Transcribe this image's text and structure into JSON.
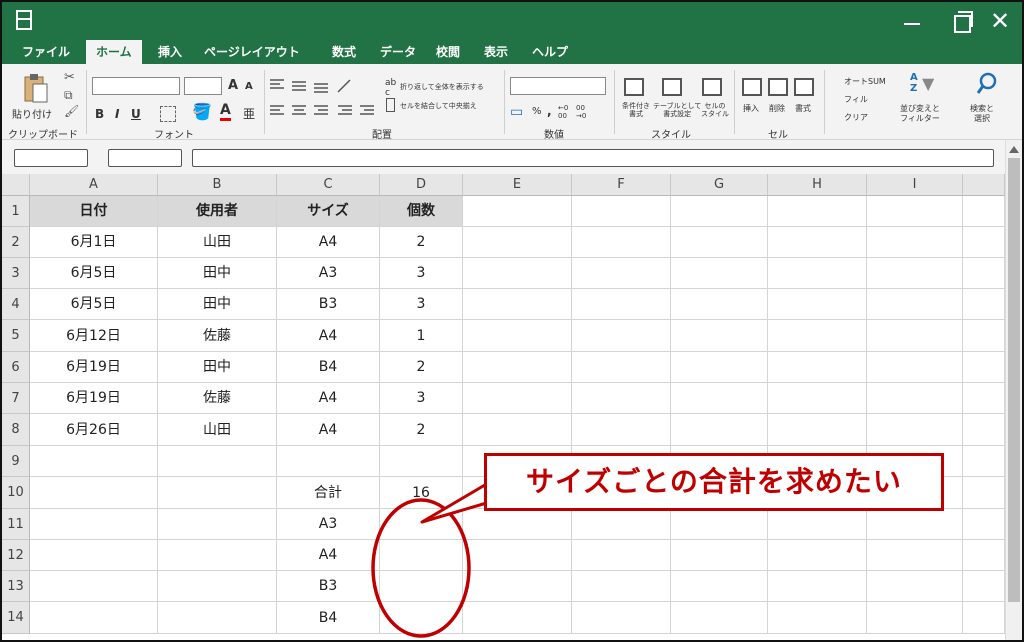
{
  "menu": {
    "tabs": [
      "ファイル",
      "ホーム",
      "挿入",
      "ページレイアウト",
      "数式",
      "データ",
      "校閲",
      "表示",
      "ヘルプ"
    ],
    "active": "ホーム"
  },
  "ribbon": {
    "clipboard": {
      "paste": "貼り付け",
      "group": "クリップボード"
    },
    "font": {
      "group": "フォント",
      "bold": "B",
      "italic": "I",
      "underline": "U",
      "grow": "A",
      "shrink": "A",
      "color": "A",
      "phonetic": "亜"
    },
    "alignment": {
      "wrap": "折り返して全体を表示する",
      "merge": "セルを結合して中央揃え",
      "group": "配置",
      "abc": "ab",
      "c": "c"
    },
    "number": {
      "group": "数値",
      "percent": "%",
      "comma": ",",
      "inc_decimal_a": "←0",
      "inc_decimal_b": "00",
      "dec_decimal_a": "00",
      "dec_decimal_b": "→0"
    },
    "styles": {
      "conditional": "条件付き\n書式",
      "table": "テーブルとして\n書式設定",
      "cell_style": "セルの\nスタイル",
      "group": "スタイル"
    },
    "cells": {
      "insert": "挿入",
      "delete": "削除",
      "format": "書式",
      "group": "セル"
    },
    "editing": {
      "autosum": "オートSUM",
      "fill": "フィル",
      "clear": "クリア",
      "sort": "並び変えと\nフィルター",
      "find": "検索と\n選択",
      "sort_icon_a": "A",
      "sort_icon_z": "Z"
    }
  },
  "columns": [
    "A",
    "B",
    "C",
    "D",
    "E",
    "F",
    "G",
    "H",
    "I"
  ],
  "rows": [
    "1",
    "2",
    "3",
    "4",
    "5",
    "6",
    "7",
    "8",
    "9",
    "10",
    "11",
    "12",
    "13",
    "14"
  ],
  "sheet": {
    "header": [
      "日付",
      "使用者",
      "サイズ",
      "個数"
    ],
    "data": [
      [
        "6月1日",
        "山田",
        "A4",
        "2"
      ],
      [
        "6月5日",
        "田中",
        "A3",
        "3"
      ],
      [
        "6月5日",
        "田中",
        "B3",
        "3"
      ],
      [
        "6月12日",
        "佐藤",
        "A4",
        "1"
      ],
      [
        "6月19日",
        "田中",
        "B4",
        "2"
      ],
      [
        "6月19日",
        "佐藤",
        "A4",
        "3"
      ],
      [
        "6月26日",
        "山田",
        "A4",
        "2"
      ]
    ],
    "total_label": "合計",
    "total_value": "16",
    "summary_sizes": [
      "A3",
      "A4",
      "B3",
      "B4"
    ]
  },
  "callout": {
    "text": "サイズごとの合計を求めたい",
    "color": "#c00000"
  },
  "colors": {
    "accent": "#217346",
    "header_fill": "#d9d9d9"
  }
}
